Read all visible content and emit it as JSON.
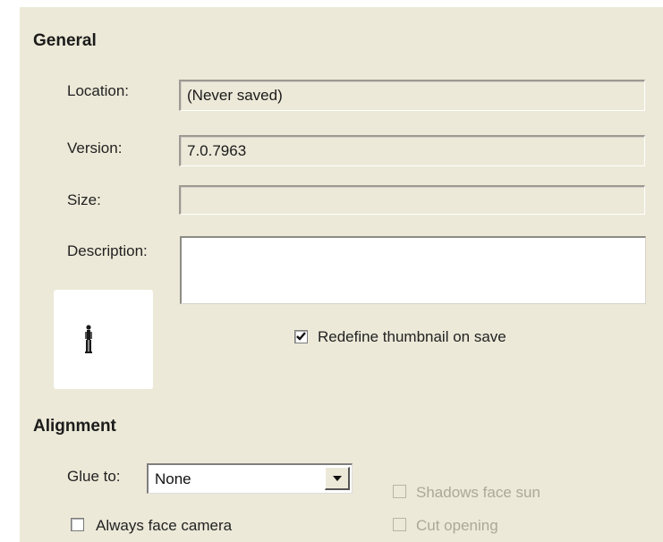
{
  "general": {
    "title": "General",
    "location": {
      "label": "Location:",
      "value": "(Never saved)"
    },
    "version": {
      "label": "Version:",
      "value": "7.0.7963"
    },
    "size": {
      "label": "Size:",
      "value": ""
    },
    "description": {
      "label": "Description:",
      "value": ""
    },
    "thumbnail_icon": "person-figure-icon",
    "redefine_thumbnail": {
      "label": "Redefine thumbnail on save",
      "checked": true
    }
  },
  "alignment": {
    "title": "Alignment",
    "glue_to": {
      "label": "Glue to:",
      "value": "None"
    },
    "always_face_camera": {
      "label": "Always face camera",
      "checked": false
    },
    "shadows_face_sun": {
      "label": "Shadows face sun",
      "checked": false,
      "enabled": false
    },
    "cut_opening": {
      "label": "Cut opening",
      "checked": false,
      "enabled": false
    }
  },
  "colors": {
    "panel_bg": "#ece9d8",
    "disabled_text": "#aca899"
  }
}
